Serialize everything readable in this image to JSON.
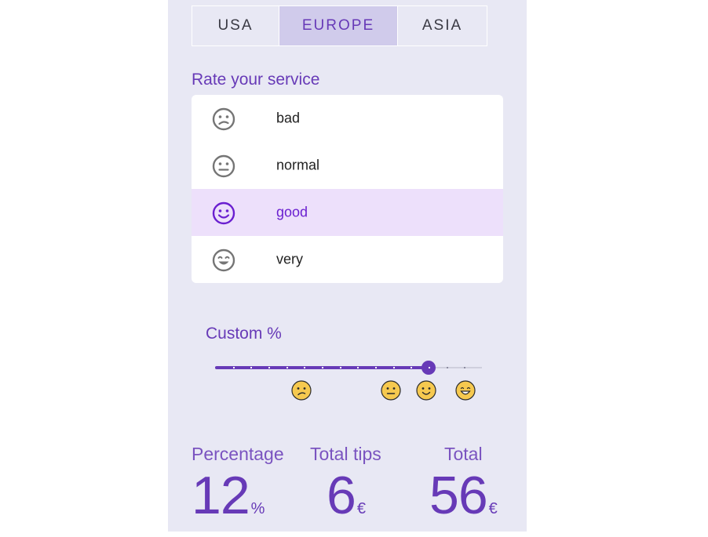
{
  "tabs": [
    {
      "label": "USA",
      "active": false
    },
    {
      "label": "EUROPE",
      "active": true
    },
    {
      "label": "ASIA",
      "active": false
    }
  ],
  "rate": {
    "title": "Rate your service",
    "options": [
      {
        "label": "bad",
        "icon": "sad-face-icon",
        "selected": false
      },
      {
        "label": "normal",
        "icon": "neutral-face-icon",
        "selected": false
      },
      {
        "label": "good",
        "icon": "smile-face-icon",
        "selected": true
      },
      {
        "label": "very",
        "icon": "grin-face-icon",
        "selected": false
      }
    ]
  },
  "custom": {
    "title": "Custom %",
    "slider_value_fraction": 0.8,
    "markers": [
      "confused-emoji-icon",
      "neutral-emoji-icon",
      "smile-emoji-icon",
      "grin-emoji-icon"
    ]
  },
  "totals": {
    "percentage": {
      "label": "Percentage",
      "value": "12",
      "unit": "%"
    },
    "tips": {
      "label": "Total tips",
      "value": "6",
      "unit": "€"
    },
    "total": {
      "label": "Total",
      "value": "56",
      "unit": "€"
    }
  },
  "colors": {
    "accent": "#673ab7",
    "panel_bg": "#e8e8f4",
    "selected_bg": "#ede0fb",
    "active_tab_bg": "#d0cbeb",
    "emoji_yellow": "#f6c94f"
  }
}
